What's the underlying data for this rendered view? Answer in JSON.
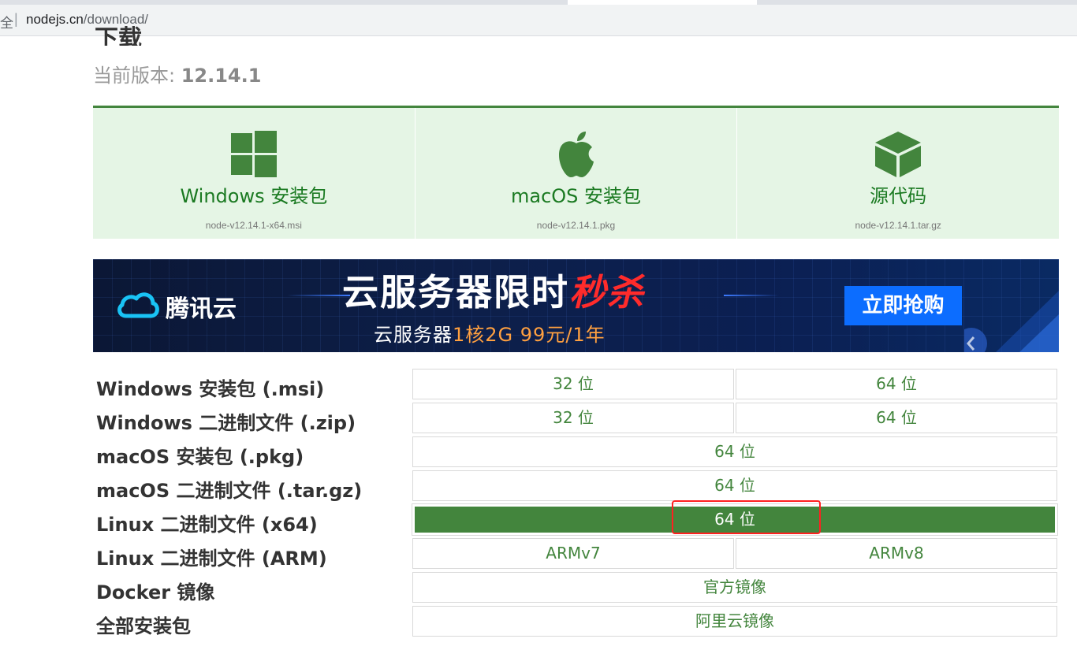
{
  "browser": {
    "left_fragment": "全",
    "url_host": "nodejs.cn",
    "url_path": "/download/"
  },
  "page": {
    "heading_partial": "下载",
    "version_label": "当前版本: ",
    "version_number": "12.14.1"
  },
  "downloads_panel": [
    {
      "label": "Windows 安装包",
      "file": "node-v12.14.1-x64.msi",
      "icon": "windows-icon"
    },
    {
      "label": "macOS 安装包",
      "file": "node-v12.14.1.pkg",
      "icon": "apple-icon"
    },
    {
      "label": "源代码",
      "file": "node-v12.14.1.tar.gz",
      "icon": "cube-icon"
    }
  ],
  "banner": {
    "brand": "腾讯云",
    "headline_main": "云服务器限时",
    "headline_hot": "秒杀",
    "sub_prefix": "云服务器",
    "sub_spec": "1核2G",
    "sub_price": "99元/1年",
    "button": "立即抢购"
  },
  "table": {
    "rows": [
      {
        "label": "Windows 安装包 (.msi)",
        "cells": [
          "32 位",
          "64 位"
        ]
      },
      {
        "label": "Windows 二进制文件 (.zip)",
        "cells": [
          "32 位",
          "64 位"
        ]
      },
      {
        "label": "macOS 安装包 (.pkg)",
        "cells": [
          "64 位"
        ]
      },
      {
        "label": "macOS 二进制文件 (.tar.gz)",
        "cells": [
          "64 位"
        ]
      },
      {
        "label": "Linux 二进制文件 (x64)",
        "cells": [
          "64 位"
        ],
        "active": true
      },
      {
        "label": "Linux 二进制文件 (ARM)",
        "cells": [
          "ARMv7",
          "ARMv8"
        ]
      },
      {
        "label": "Docker 镜像",
        "cells": [
          "官方镜像"
        ]
      },
      {
        "label": "全部安装包",
        "cells": [
          "阿里云镜像"
        ]
      }
    ]
  },
  "colors": {
    "node_green": "#43853d",
    "panel_bg": "#e5f5e5",
    "highlight_red": "#ff2020"
  }
}
